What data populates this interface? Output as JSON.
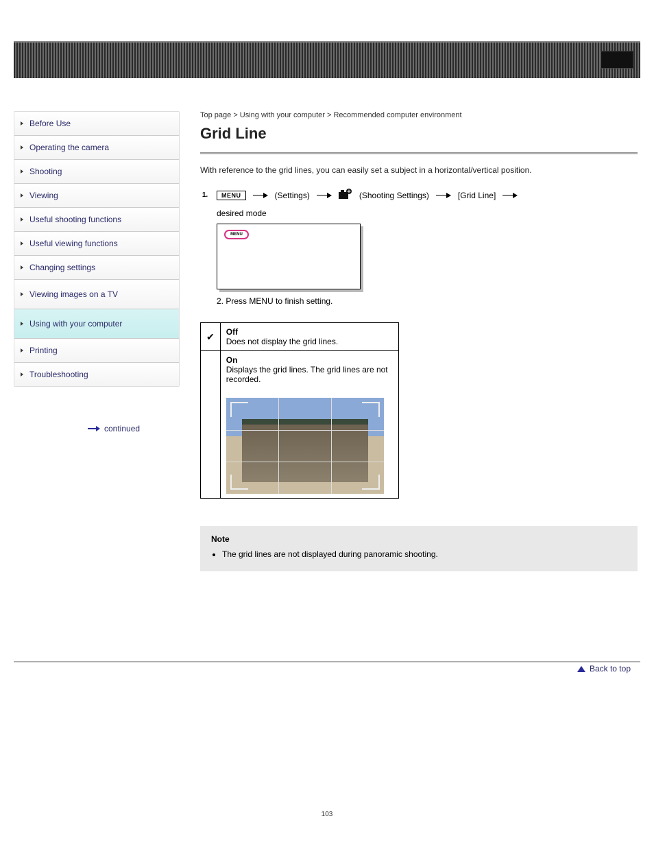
{
  "sidebar": {
    "items": [
      {
        "label": "Before Use"
      },
      {
        "label": "Operating the camera"
      },
      {
        "label": "Shooting"
      },
      {
        "label": "Viewing"
      },
      {
        "label": "Useful shooting functions"
      },
      {
        "label": "Useful viewing functions"
      },
      {
        "label": "Changing settings"
      },
      {
        "label": "Viewing images on a TV"
      },
      {
        "label": "Using with your computer"
      },
      {
        "label": "Printing"
      },
      {
        "label": "Troubleshooting"
      }
    ],
    "active_index": 8,
    "continue": "continued"
  },
  "breadcrumb": "Top page > Using with your computer > Recommended computer environment",
  "page_title": "Grid Line",
  "intro": "With reference to the grid lines, you can easily set a subject in a horizontal/vertical position.",
  "step1": {
    "menu_label": "MENU",
    "settings_label": "(Settings)",
    "sub_label": "(Shooting Settings)",
    "item_label": "[Grid Line]",
    "tail": "desired mode"
  },
  "step2": "2. Press MENU to finish setting.",
  "screen_menu": "MENU",
  "options": {
    "off": {
      "label": "Off",
      "desc": "Does not display the grid lines."
    },
    "on": {
      "label": "On",
      "desc": "Displays the grid lines. The grid lines are not recorded."
    }
  },
  "note": {
    "title": "Note",
    "items": [
      "The grid lines are not displayed during panoramic shooting."
    ]
  },
  "back_to_top": "Back to top",
  "page_number": "103"
}
